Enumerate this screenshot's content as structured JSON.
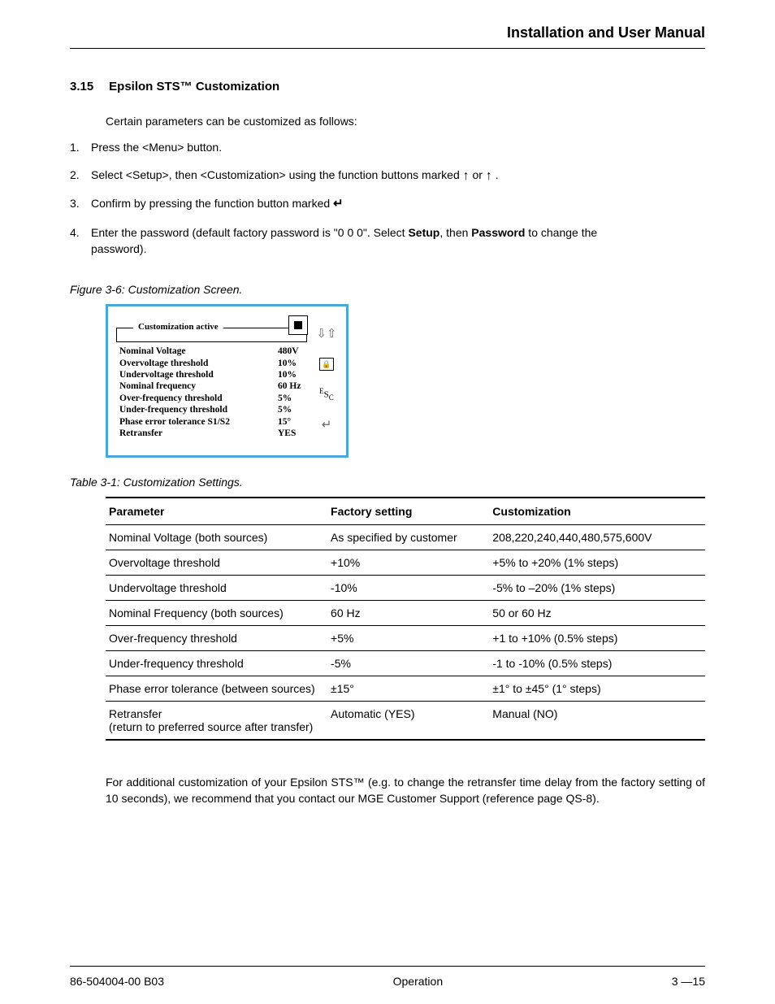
{
  "header": {
    "title": "Installation and User Manual"
  },
  "section": {
    "number": "3.15",
    "title": "Epsilon STS™ Customization",
    "intro": "Certain parameters can be customized as follows:",
    "steps": {
      "s1": {
        "ord": "1.",
        "text": "Press the <Menu> button."
      },
      "s2": {
        "ord": "2.",
        "pre": "Select <Setup>, then <Customization> using the function buttons marked ",
        "mid": " or ",
        "post": "."
      },
      "s3": {
        "ord": "3.",
        "text": "Confirm by pressing the function button marked "
      },
      "s4": {
        "ord": "4.",
        "line1_a": "Enter the password (default factory password is \"0 0 0\".  Select ",
        "bold1": "Setup",
        "line1_b": ", then ",
        "bold2": "Password",
        "line1_c": " to change the",
        "line2": "password)."
      }
    }
  },
  "figure": {
    "caption": "Figure 3-6:  Customization Screen.",
    "legend": "Customization active",
    "rows": [
      {
        "label": "Nominal Voltage",
        "value": "480V"
      },
      {
        "label": "Overvoltage threshold",
        "value": "10%"
      },
      {
        "label": "Undervoltage threshold",
        "value": "10%"
      },
      {
        "label": "Nominal frequency",
        "value": "60 Hz"
      },
      {
        "label": "Over-frequency threshold",
        "value": "5%"
      },
      {
        "label": "Under-frequency threshold",
        "value": "5%"
      },
      {
        "label": "Phase error tolerance S1/S2",
        "value": "15°"
      },
      {
        "label": "Retransfer",
        "value": "YES"
      }
    ],
    "sidebar": {
      "updown": "⇩⇧",
      "lock": "🔒",
      "esc": "ESC",
      "enter": "↵"
    }
  },
  "table": {
    "caption": "Table 3-1:   Customization Settings.",
    "headers": {
      "h1": "Parameter",
      "h2": "Factory setting",
      "h3": "Customization"
    },
    "rows": [
      {
        "p": "Nominal Voltage (both sources)",
        "f": "As specified by customer",
        "c": "208,220,240,440,480,575,600V"
      },
      {
        "p": "Overvoltage threshold",
        "f": "+10%",
        "c": "+5% to +20% (1% steps)"
      },
      {
        "p": "Undervoltage threshold",
        "f": "-10%",
        "c": "-5% to –20% (1% steps)"
      },
      {
        "p": "Nominal Frequency (both sources)",
        "f": "60 Hz",
        "c": "50 or 60 Hz"
      },
      {
        "p": "Over-frequency threshold",
        "f": "+5%",
        "c": "+1 to +10% (0.5% steps)"
      },
      {
        "p": "Under-frequency threshold",
        "f": "-5%",
        "c": "-1 to -10% (0.5% steps)"
      },
      {
        "p": "Phase error tolerance (between sources)",
        "f": "±15°",
        "c": "±1° to ±45° (1° steps)"
      },
      {
        "p": "Retransfer\n(return to preferred source after transfer)",
        "f": "Automatic (YES)",
        "c": "Manual (NO)"
      }
    ]
  },
  "closing": "For additional customization of your Epsilon STS™ (e.g. to change the retransfer time delay from the factory setting of 10 seconds), we recommend that you contact our MGE Customer Support (reference page QS-8).",
  "footer": {
    "left": "86-504004-00 B03",
    "center": "Operation",
    "right": "3 —15"
  }
}
